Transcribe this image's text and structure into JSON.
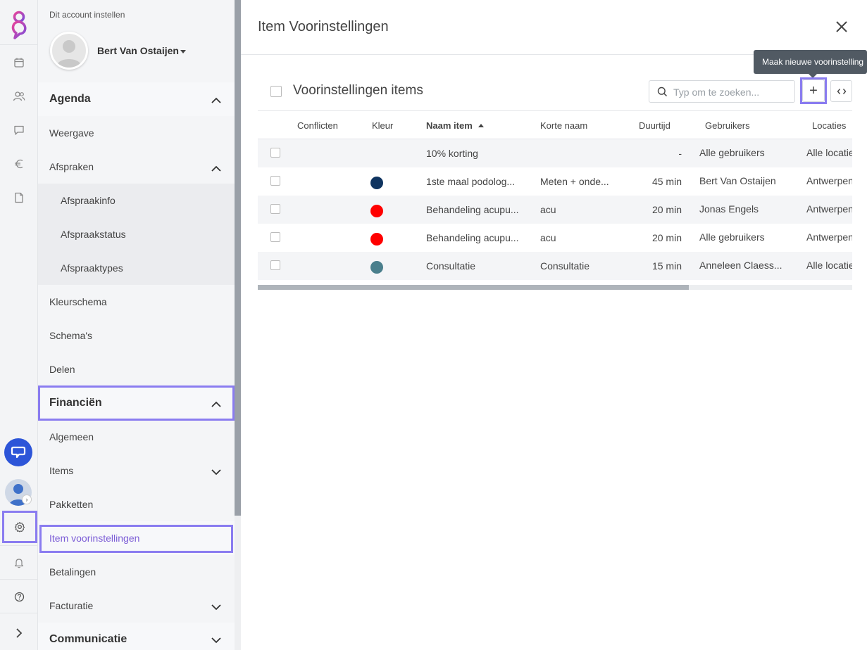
{
  "app": {
    "account_setup_label": "Dit account instellen",
    "user_name": "Bert Van Ostaijen"
  },
  "sidebar": {
    "agenda": {
      "label": "Agenda",
      "items": {
        "weergave": "Weergave",
        "afspraken": "Afspraken",
        "afspraakinfo": "Afspraakinfo",
        "afspraakstatus": "Afspraakstatus",
        "afspraaktypes": "Afspraaktypes",
        "kleurschema": "Kleurschema",
        "schemas": "Schema's",
        "delen": "Delen"
      }
    },
    "financien": {
      "label": "Financiën",
      "items": {
        "algemeen": "Algemeen",
        "items": "Items",
        "pakketten": "Pakketten",
        "item_voorinstellingen": "Item voorinstellingen",
        "betalingen": "Betalingen",
        "facturatie": "Facturatie"
      }
    },
    "communicatie": {
      "label": "Communicatie"
    }
  },
  "main": {
    "title": "Item Voorinstellingen",
    "table_title": "Voorinstellingen items",
    "search_placeholder": "Typ om te zoeken...",
    "add_label": "+",
    "tooltip": "Maak nieuwe voorinstelling",
    "columns": {
      "conflicten": "Conflicten",
      "kleur": "Kleur",
      "naam": "Naam item",
      "korte_naam": "Korte naam",
      "duurtijd": "Duurtijd",
      "gebruikers": "Gebruikers",
      "locaties": "Locaties"
    },
    "rows": [
      {
        "naam": "10% korting",
        "korte_naam": "",
        "duurtijd": "-",
        "gebruikers": "Alle gebruikers",
        "locaties": "Alle locaties",
        "color": ""
      },
      {
        "naam": "1ste maal podolog...",
        "korte_naam": "Meten + onde...",
        "duurtijd": "45 min",
        "gebruikers": "Bert Van Ostaijen",
        "locaties": "Antwerpen",
        "color": "#0f3460"
      },
      {
        "naam": "Behandeling acupu...",
        "korte_naam": "acu",
        "duurtijd": "20 min",
        "gebruikers": "Jonas Engels",
        "locaties": "Antwerpen",
        "color": "#ff0000"
      },
      {
        "naam": "Behandeling acupu...",
        "korte_naam": "acu",
        "duurtijd": "20 min",
        "gebruikers": "Alle gebruikers",
        "locaties": "Antwerpen",
        "color": "#ff0000"
      },
      {
        "naam": "Consultatie",
        "korte_naam": "Consultatie",
        "duurtijd": "15 min",
        "gebruikers": "Anneleen Claess...",
        "locaties": "Alle locaties",
        "color": "#4a7f8c"
      }
    ]
  },
  "colors": {
    "accent_highlight": "#8a7cf0",
    "active_link": "#7b5cd6",
    "chat_button": "#2d55d8"
  },
  "icons": [
    "logo-icon",
    "calendar-icon",
    "users-icon",
    "chat-icon",
    "euro-icon",
    "document-icon",
    "chat-bubble-icon",
    "gear-icon",
    "bell-icon",
    "help-icon",
    "expand-icon",
    "chevron-up-icon",
    "chevron-down-icon",
    "close-icon",
    "search-icon",
    "code-icon"
  ]
}
